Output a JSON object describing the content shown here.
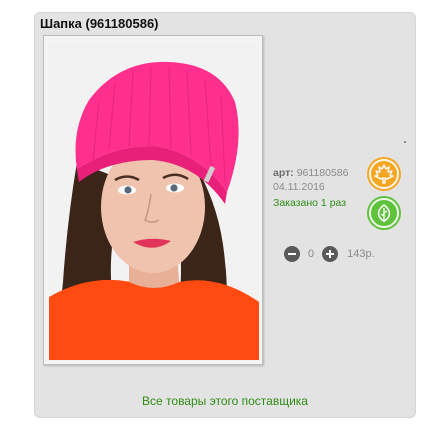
{
  "product": {
    "title": "Шапка (961180586)",
    "image_alt": "Шапка",
    "article_label": "арт:",
    "article_value": "961180586",
    "date": "04.11.2016",
    "ordered_text": "Заказано 1 раз"
  },
  "badges": [
    {
      "name": "maple-leaf-icon",
      "color": "#f5a623"
    },
    {
      "name": "leaf-icon",
      "color": "#5ec33a"
    }
  ],
  "quantity": {
    "count": "0",
    "price": "143р."
  },
  "footer": {
    "supplier_link": "Все товары этого поставщика"
  }
}
